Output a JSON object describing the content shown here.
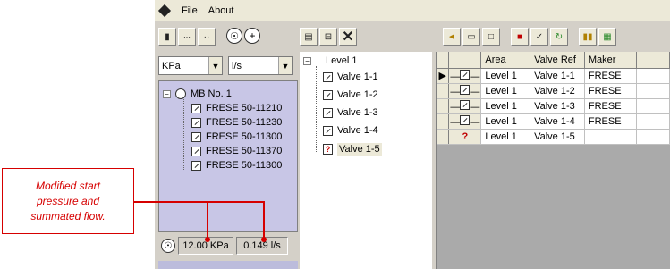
{
  "menu": {
    "file": "File",
    "about": "About"
  },
  "toolbar_left": [
    "pin-icon",
    "dots-icon",
    "dash-icon",
    "globe-icon",
    "add-circle-icon"
  ],
  "toolbar_mid": [
    "list-icon",
    "minus-box-icon",
    "close-icon"
  ],
  "toolbar_right": [
    "folder-icon",
    "window-icon",
    "new-page-icon",
    "save-icon",
    "check-icon",
    "refresh-icon",
    "chart-icon",
    "export-icon"
  ],
  "units": {
    "pressure": "KPa",
    "flow": "l/s"
  },
  "left_tree": {
    "root": "MB No. 1",
    "items": [
      "FRESE 50-11210",
      "FRESE 50-11230",
      "FRESE 50-11300",
      "FRESE 50-11370",
      "FRESE 50-11300"
    ]
  },
  "status": {
    "pressure": "12.00 KPa",
    "flow": "0.149 l/s"
  },
  "mid_tree": {
    "root": "Level 1",
    "items": [
      "Valve 1-1",
      "Valve 1-2",
      "Valve 1-3",
      "Valve 1-4",
      "Valve 1-5"
    ]
  },
  "grid": {
    "columns": [
      "Area",
      "Valve Ref",
      "Maker"
    ],
    "rows": [
      {
        "area": "Level 1",
        "valve": "Valve 1-1",
        "maker": "FRESE"
      },
      {
        "area": "Level 1",
        "valve": "Valve 1-2",
        "maker": "FRESE"
      },
      {
        "area": "Level 1",
        "valve": "Valve 1-3",
        "maker": "FRESE"
      },
      {
        "area": "Level 1",
        "valve": "Valve 1-4",
        "maker": "FRESE"
      },
      {
        "area": "Level 1",
        "valve": "Valve 1-5",
        "maker": ""
      }
    ]
  },
  "annotation": {
    "line1": "Modified start",
    "line2": "pressure and",
    "line3": "summated flow."
  },
  "colors": {
    "annotation": "#d60000",
    "tree_bg": "#c8c6e6"
  }
}
